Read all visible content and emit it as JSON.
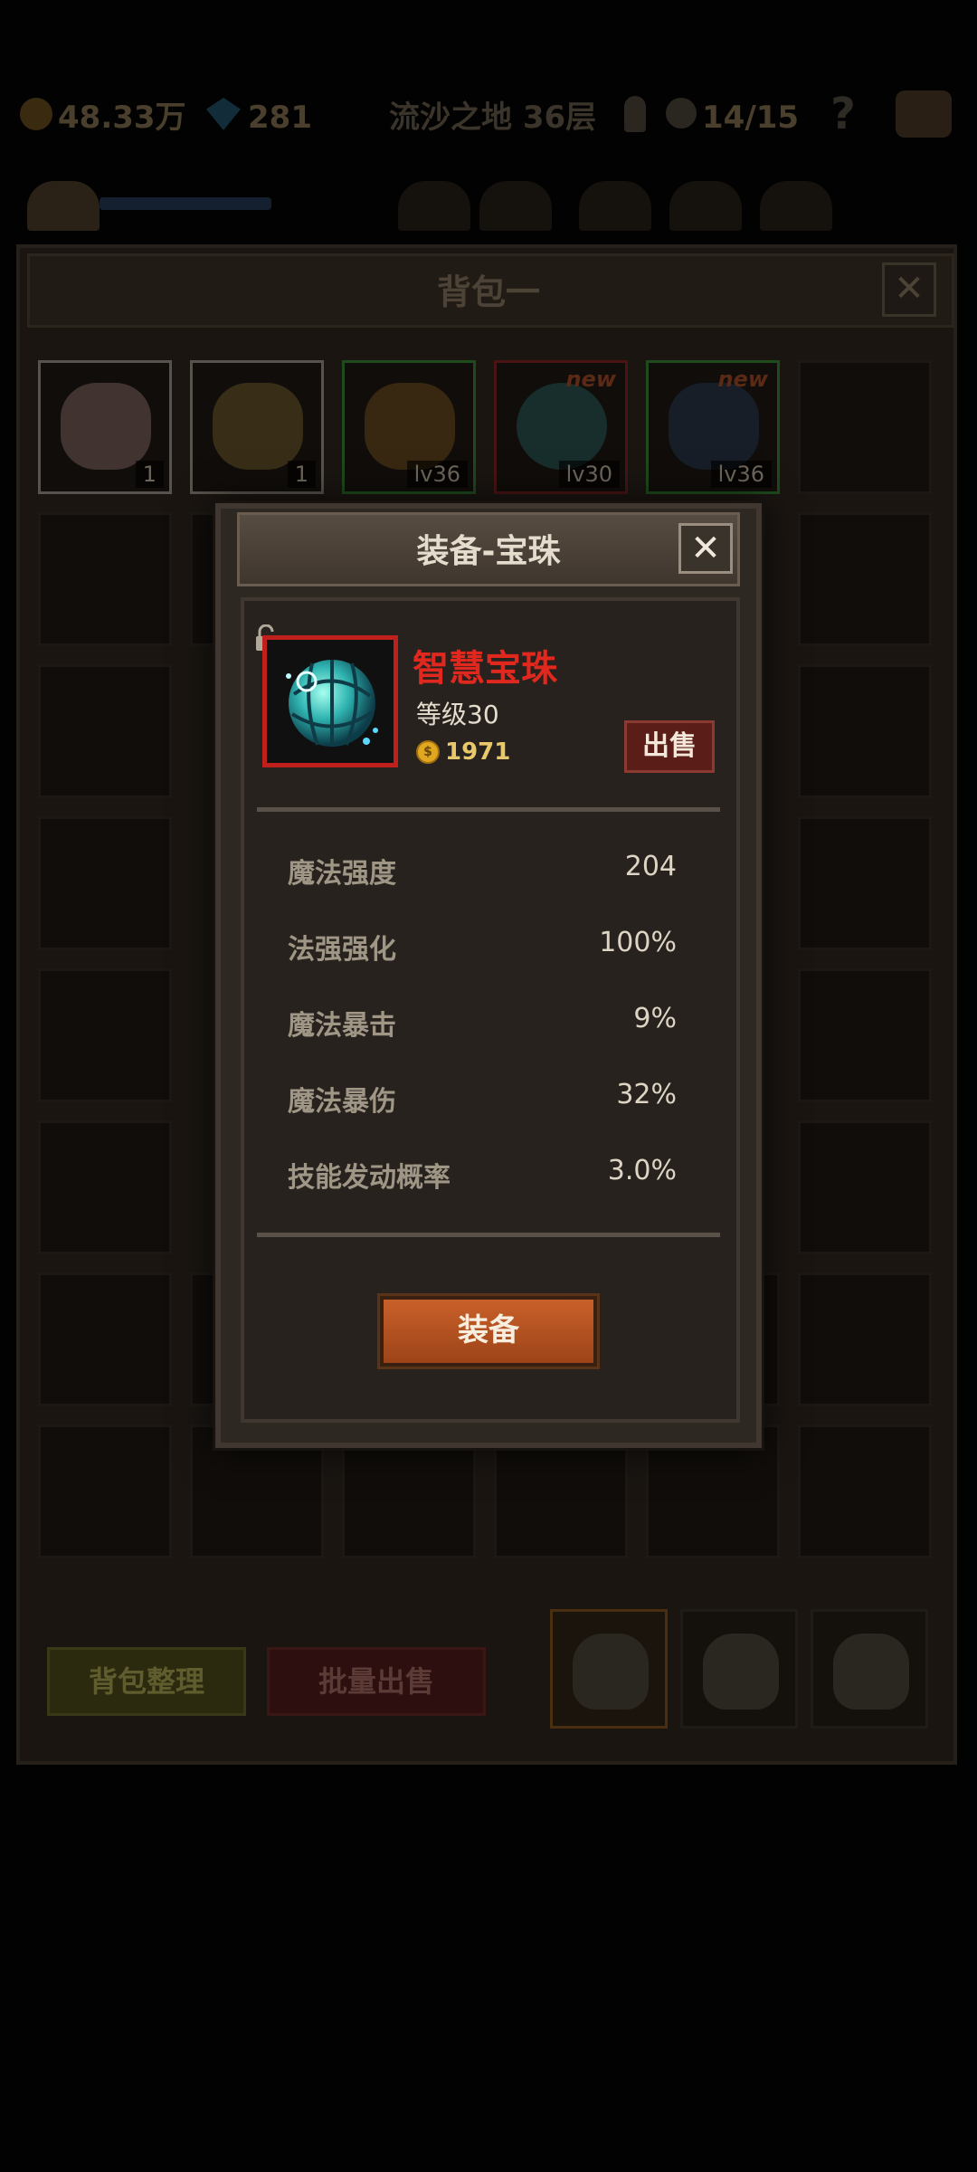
{
  "status_bar": {
    "gold": "48.33万",
    "gems": "281",
    "stage": "流沙之地 36层",
    "skull_count": "14/15",
    "help": "?"
  },
  "bag": {
    "title": "背包一",
    "close": "✕",
    "slots": [
      {
        "label": "1",
        "rarity": "white",
        "icon": "cake-icon"
      },
      {
        "label": "1",
        "rarity": "white",
        "icon": "beer-mug-icon"
      },
      {
        "label": "lv36",
        "rarity": "green",
        "icon": "ring-icon"
      },
      {
        "label": "lv30",
        "rarity": "red",
        "icon": "orb-icon",
        "new": "new"
      },
      {
        "label": "lv36",
        "rarity": "green",
        "icon": "armor-icon",
        "new": "new"
      }
    ],
    "sort_button": "背包整理",
    "bulk_sell_button": "批量出售"
  },
  "modal": {
    "title": "装备-宝珠",
    "close": "✕",
    "item": {
      "name": "智慧宝珠",
      "level": "等级30",
      "price": "1971",
      "icon": "wisdom-orb-icon",
      "frame_color": "#c0201c"
    },
    "sell_button": "出售",
    "stats": [
      {
        "label": "魔法强度",
        "value": "204"
      },
      {
        "label": "法强强化",
        "value": "100%"
      },
      {
        "label": "魔法暴击",
        "value": "9%"
      },
      {
        "label": "魔法暴伤",
        "value": "32%"
      },
      {
        "label": "技能发动概率",
        "value": "3.0%"
      }
    ],
    "equip_button": "装备"
  },
  "colors": {
    "item_name": "#e0281e",
    "price": "#e8c86a",
    "equip_button": "#b8541f",
    "sell_button": "#5a1d18"
  }
}
